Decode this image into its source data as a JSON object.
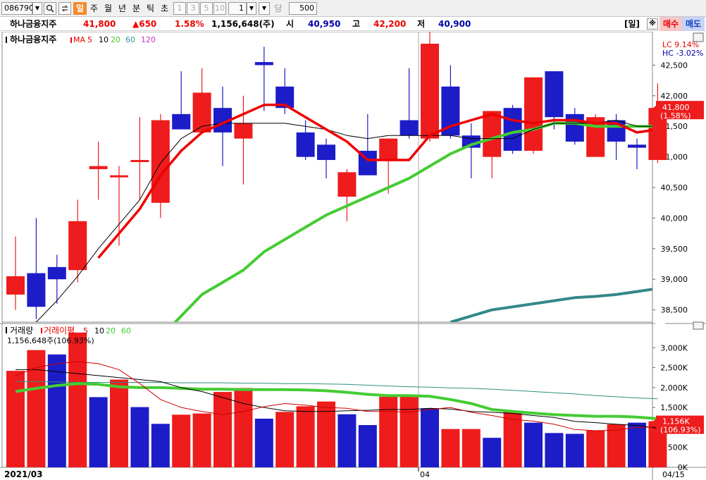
{
  "toolbar": {
    "code": "086790",
    "periods": [
      "일",
      "주",
      "월",
      "년",
      "분",
      "틱",
      "초"
    ],
    "active_period": "일",
    "intervals": [
      "1",
      "3",
      "5",
      "10"
    ],
    "interval_input": "1",
    "dang_label": "당",
    "count_input": "500"
  },
  "info": {
    "name": "하나금융지주",
    "price": "41,800",
    "change": "▲650",
    "rate": "1.58%",
    "volume": "1,156,648(주)",
    "open_label": "시",
    "open": "40,950",
    "high_label": "고",
    "high": "42,200",
    "low_label": "저",
    "low": "40,900",
    "period_tag": "[일]",
    "buy_label": "매수",
    "sell_label": "매도"
  },
  "price_panel": {
    "title": "하나금융지주",
    "ma_label": "MA",
    "ma_periods": [
      "5",
      "10",
      "20",
      "60",
      "120"
    ],
    "lc": "LC  9.14%",
    "hc": "HC -3.02%",
    "current_price": "41,800",
    "current_rate": "(1.58%)",
    "yticks": [
      "42,500",
      "42,000",
      "41,500",
      "41,000",
      "40,500",
      "40,000",
      "39,500",
      "39,000",
      "38,500"
    ]
  },
  "volume_panel": {
    "title": "거래량",
    "avg_label": "거래이평",
    "avg_periods": [
      "5",
      "10",
      "20",
      "60"
    ],
    "readout": "1,156,648주(106.93%)",
    "current_vol": "1,156K",
    "current_rate": "(106.93%)",
    "yticks": [
      "3,000K",
      "2,500K",
      "2,000K",
      "1,500K",
      "1,000K",
      "500K",
      "0K"
    ]
  },
  "xaxis": {
    "start": "2021/03",
    "mid": "04",
    "end": "04/15"
  },
  "colors": {
    "up": "#ee1c1c",
    "down": "#1c1cc8",
    "ma5": "#ee0000",
    "ma10": "#000000",
    "ma20": "#44cc33",
    "ma60": "#338888",
    "vol_ma5": "#cc0000",
    "vol_ma10": "#000000",
    "vol_ma20": "#44cc33",
    "vol_ma60": "#2f8f7f"
  },
  "chart_data": [
    {
      "type": "candlestick",
      "title": "하나금융지주",
      "ylim": [
        38300,
        43000
      ],
      "candles": [
        {
          "o": 38750,
          "h": 39700,
          "l": 38500,
          "c": 39050
        },
        {
          "o": 39100,
          "h": 40000,
          "l": 38350,
          "c": 38550
        },
        {
          "o": 39200,
          "h": 39400,
          "l": 38600,
          "c": 39000
        },
        {
          "o": 39150,
          "h": 40300,
          "l": 38950,
          "c": 39950
        },
        {
          "o": 40800,
          "h": 41250,
          "l": 40300,
          "c": 40850
        },
        {
          "o": 40700,
          "h": 40850,
          "l": 39550,
          "c": 40700
        },
        {
          "o": 40950,
          "h": 41650,
          "l": 40300,
          "c": 40950
        },
        {
          "o": 40250,
          "h": 41700,
          "l": 40000,
          "c": 41600
        },
        {
          "o": 41700,
          "h": 42400,
          "l": 41500,
          "c": 41450
        },
        {
          "o": 41400,
          "h": 42450,
          "l": 41400,
          "c": 42050
        },
        {
          "o": 41800,
          "h": 42150,
          "l": 40850,
          "c": 41400
        },
        {
          "o": 41300,
          "h": 42000,
          "l": 40550,
          "c": 41550
        },
        {
          "o": 42550,
          "h": 42800,
          "l": 41750,
          "c": 42500
        },
        {
          "o": 42150,
          "h": 42450,
          "l": 41700,
          "c": 41800
        },
        {
          "o": 41400,
          "h": 41600,
          "l": 40950,
          "c": 41000
        },
        {
          "o": 41200,
          "h": 41300,
          "l": 40650,
          "c": 40950
        },
        {
          "o": 40350,
          "h": 40800,
          "l": 39950,
          "c": 40750
        },
        {
          "o": 41100,
          "h": 41700,
          "l": 40700,
          "c": 40700
        },
        {
          "o": 40950,
          "h": 41300,
          "l": 40400,
          "c": 41300
        },
        {
          "o": 41600,
          "h": 42450,
          "l": 41300,
          "c": 41350
        },
        {
          "o": 41300,
          "h": 43050,
          "l": 41250,
          "c": 42850
        },
        {
          "o": 42150,
          "h": 42500,
          "l": 41300,
          "c": 41350
        },
        {
          "o": 41350,
          "h": 41550,
          "l": 40650,
          "c": 41150
        },
        {
          "o": 41000,
          "h": 41750,
          "l": 40650,
          "c": 41750
        },
        {
          "o": 41800,
          "h": 41850,
          "l": 41050,
          "c": 41100
        },
        {
          "o": 41100,
          "h": 42300,
          "l": 41050,
          "c": 42300
        },
        {
          "o": 42400,
          "h": 42400,
          "l": 41450,
          "c": 41650
        },
        {
          "o": 41700,
          "h": 41800,
          "l": 41200,
          "c": 41250
        },
        {
          "o": 41000,
          "h": 41700,
          "l": 41000,
          "c": 41650
        },
        {
          "o": 41600,
          "h": 41700,
          "l": 40950,
          "c": 41250
        },
        {
          "o": 41200,
          "h": 41300,
          "l": 40800,
          "c": 41150
        },
        {
          "o": 40950,
          "h": 42200,
          "l": 40900,
          "c": 41800
        }
      ],
      "ma5": [
        null,
        null,
        null,
        null,
        39350,
        39750,
        40150,
        40700,
        41100,
        41400,
        41550,
        41700,
        41850,
        41850,
        41650,
        41450,
        41250,
        40950,
        40950,
        40950,
        41350,
        41500,
        41600,
        41700,
        41600,
        41550,
        41600,
        41600,
        41550,
        41550,
        41400,
        41450
      ],
      "ma10": [
        38050,
        38300,
        38650,
        39050,
        39500,
        39900,
        40300,
        40900,
        41300,
        41500,
        41550,
        41550,
        41550,
        41550,
        41500,
        41450,
        41350,
        41300,
        41350,
        41350,
        41350,
        41350,
        41300,
        41300,
        41300,
        41450,
        41550,
        41550,
        41550,
        41600,
        41500,
        41500
      ],
      "ma20": [
        null,
        null,
        null,
        null,
        null,
        null,
        37700,
        38050,
        38400,
        38750,
        38950,
        39150,
        39450,
        39650,
        39850,
        40050,
        40200,
        40350,
        40500,
        40650,
        40850,
        41050,
        41200,
        41300,
        41400,
        41450,
        41550,
        41550,
        41500,
        41500,
        41500,
        41500
      ],
      "ma60": [
        null,
        null,
        null,
        null,
        null,
        null,
        null,
        null,
        null,
        null,
        null,
        null,
        null,
        null,
        null,
        null,
        null,
        null,
        null,
        null,
        null,
        38300,
        38400,
        38500,
        38550,
        38600,
        38650,
        38700,
        38720,
        38750,
        38800,
        38850
      ]
    },
    {
      "type": "bar",
      "title": "거래량",
      "ylim": [
        0,
        3500
      ],
      "unit": "K",
      "values": [
        2420,
        2940,
        2830,
        3380,
        1760,
        2200,
        1510,
        1090,
        1320,
        1350,
        1890,
        1990,
        1220,
        1390,
        1530,
        1650,
        1330,
        1060,
        1770,
        1770,
        1480,
        960,
        960,
        740,
        1410,
        1120,
        860,
        840,
        920,
        1080,
        1120,
        1156
      ],
      "up": [
        1,
        1,
        0,
        1,
        0,
        1,
        0,
        0,
        1,
        1,
        1,
        1,
        0,
        1,
        1,
        1,
        0,
        0,
        1,
        1,
        0,
        1,
        1,
        0,
        1,
        0,
        0,
        0,
        1,
        1,
        0,
        1
      ],
      "avg5": [
        2300,
        2500,
        2600,
        2650,
        2600,
        2450,
        2100,
        1700,
        1500,
        1400,
        1320,
        1400,
        1520,
        1600,
        1560,
        1500,
        1480,
        1400,
        1400,
        1380,
        1450,
        1500,
        1380,
        1300,
        1200,
        1160,
        1080,
        950,
        920,
        930,
        1000,
        1010
      ],
      "avg10": [
        2450,
        2450,
        2400,
        2350,
        2300,
        2250,
        2200,
        2150,
        2000,
        1900,
        1750,
        1600,
        1500,
        1420,
        1400,
        1400,
        1420,
        1430,
        1450,
        1450,
        1480,
        1460,
        1400,
        1380,
        1350,
        1300,
        1250,
        1150,
        1120,
        1080,
        1050,
        980
      ],
      "avg20": [
        1900,
        1980,
        2050,
        2100,
        2080,
        2020,
        2000,
        2000,
        1980,
        1960,
        1960,
        1950,
        1950,
        1950,
        1940,
        1920,
        1880,
        1830,
        1800,
        1800,
        1780,
        1700,
        1600,
        1450,
        1400,
        1360,
        1320,
        1300,
        1280,
        1280,
        1260,
        1220
      ],
      "avg60": [
        2150,
        2150,
        2140,
        2130,
        2130,
        2130,
        2130,
        2130,
        2120,
        2120,
        2120,
        2110,
        2110,
        2100,
        2100,
        2090,
        2080,
        2060,
        2040,
        2020,
        2010,
        1990,
        1980,
        1960,
        1930,
        1900,
        1870,
        1840,
        1800,
        1770,
        1740,
        1720
      ]
    }
  ]
}
